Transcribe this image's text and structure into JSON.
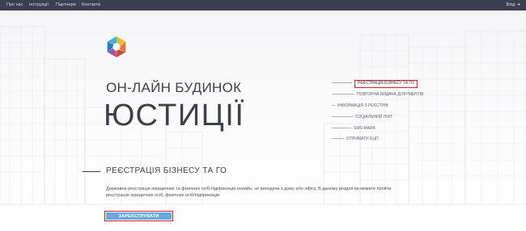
{
  "nav": {
    "items": [
      {
        "label": "Про нас"
      },
      {
        "label": "Інструкції"
      },
      {
        "label": "Партнери"
      },
      {
        "label": "Контакти"
      }
    ],
    "login_label": "Вхід",
    "login_icon": "sign-in-icon"
  },
  "hero": {
    "logo_icon": "camera-aperture-logo",
    "title_line1": "ОН-ЛАЙН БУДИНОК",
    "title_line2": "ЮСТИЦІЇ"
  },
  "services_menu": {
    "items": [
      {
        "label": "РЕЄСТРАЦІЯ БІЗНЕСУ ТА ГО",
        "active": true
      },
      {
        "label": "ПОВТОРНА ВИДАЧА ДОКУМЕНТІВ",
        "active": false
      },
      {
        "label": "ІНФОРМАЦІЯ З РЕЄСТРІВ",
        "active": false
      },
      {
        "label": "СОЦІАЛЬНИЙ ЛІФТ",
        "active": false
      },
      {
        "label": "SMS-MARK",
        "active": false
      },
      {
        "label": "ОТРИМАТИ ЕЦП",
        "active": false
      }
    ]
  },
  "section": {
    "title": "РЕЄСТРАЦІЯ БІЗНЕСУ ТА ГО",
    "description": "Державна реєстрація юридичних та фізичних осіб-підприємців онлайн, не виходячи з дому або офісу. В даному розділі ви можете пройти реєстрацію юридичних осіб, фізичних осіб/підприємців",
    "button_label": "ЗАРЕЄСТРУВАТИ"
  },
  "colors": {
    "topbar": "#3a4050",
    "accent_red": "#d3202a",
    "button_blue": "#6aa7dc",
    "text_dark": "#3b404c"
  }
}
